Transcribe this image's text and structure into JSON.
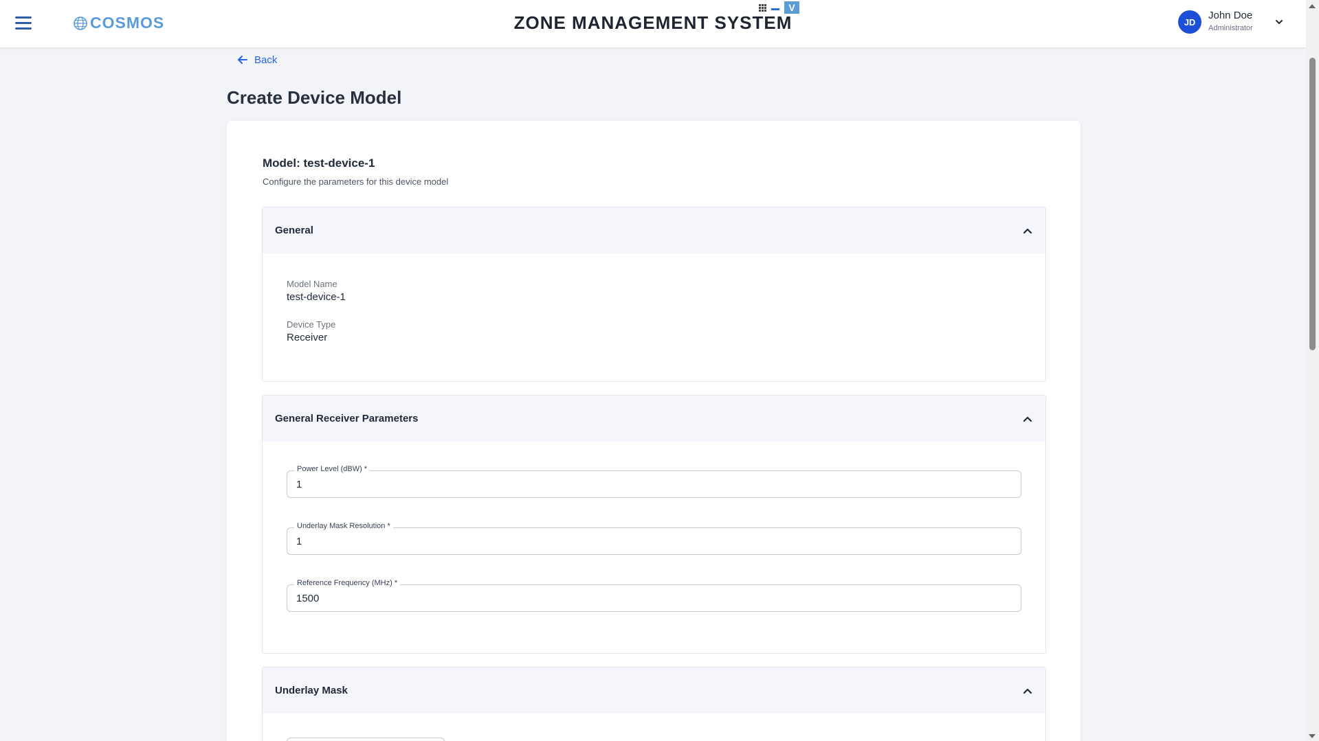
{
  "header": {
    "logo_text": "COSMOS",
    "title": "ZONE MANAGEMENT SYSTEM",
    "window_controls": {
      "restore_label": "V"
    }
  },
  "user": {
    "initials": "JD",
    "name": "John Doe",
    "role": "Administrator"
  },
  "nav": {
    "back_label": "Back"
  },
  "page": {
    "title": "Create Device Model",
    "model_heading": "Model: test-device-1",
    "model_subtitle": "Configure the parameters for this device model"
  },
  "sections": {
    "general": {
      "title": "General",
      "model_name_label": "Model Name",
      "model_name_value": "test-device-1",
      "device_type_label": "Device Type",
      "device_type_value": "Receiver"
    },
    "receiver": {
      "title": "General Receiver Parameters",
      "fields": [
        {
          "label": "Power Level (dBW) *",
          "value": "1"
        },
        {
          "label": "Underlay Mask Resolution *",
          "value": "1"
        },
        {
          "label": "Reference Frequency (MHz) *",
          "value": "1500"
        }
      ]
    },
    "underlay": {
      "title": "Underlay Mask"
    }
  },
  "icons": {
    "menu": "hamburger-menu-icon",
    "back": "arrow-left-icon",
    "collapse": "chevron-up-icon",
    "user_menu": "chevron-down-icon"
  },
  "colors": {
    "accent": "#2563eb",
    "logo": "#5a9bd8",
    "avatar": "#1d4ed8",
    "section_header_bg": "#f4f6fb",
    "page_bg": "#f3f4f8"
  }
}
